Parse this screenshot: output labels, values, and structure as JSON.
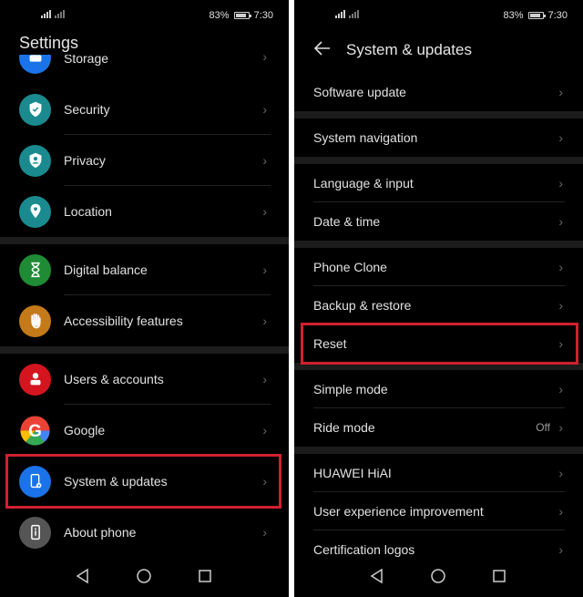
{
  "status_bar": {
    "battery": "83%",
    "time": "7:30"
  },
  "left": {
    "title": "Settings",
    "partial_item": {
      "label": "Storage",
      "icon": "storage-icon",
      "color": "#1a73e8"
    },
    "groups": [
      [
        {
          "label": "Security",
          "icon": "shield-check-icon",
          "color": "#1a8a8f"
        },
        {
          "label": "Privacy",
          "icon": "privacy-shield-icon",
          "color": "#1a8a8f"
        },
        {
          "label": "Location",
          "icon": "location-pin-icon",
          "color": "#1a8a8f"
        }
      ],
      [
        {
          "label": "Digital balance",
          "icon": "hourglass-icon",
          "color": "#1f8c35"
        },
        {
          "label": "Accessibility features",
          "icon": "hand-icon",
          "color": "#c47a18"
        }
      ],
      [
        {
          "label": "Users & accounts",
          "icon": "user-icon",
          "color": "#d4151f"
        },
        {
          "label": "Google",
          "icon": "google-icon",
          "color": "#ffffff"
        },
        {
          "label": "System & updates",
          "icon": "phone-gear-icon",
          "color": "#1a73e8",
          "highlighted": true
        },
        {
          "label": "About phone",
          "icon": "phone-info-icon",
          "color": "#555555"
        }
      ]
    ]
  },
  "right": {
    "title": "System & updates",
    "groups": [
      [
        {
          "label": "Software update"
        }
      ],
      [
        {
          "label": "System navigation"
        }
      ],
      [
        {
          "label": "Language & input"
        },
        {
          "label": "Date & time"
        }
      ],
      [
        {
          "label": "Phone Clone"
        },
        {
          "label": "Backup & restore"
        },
        {
          "label": "Reset",
          "highlighted": true
        }
      ],
      [
        {
          "label": "Simple mode"
        },
        {
          "label": "Ride mode",
          "value": "Off"
        }
      ],
      [
        {
          "label": "HUAWEI HiAI"
        },
        {
          "label": "User experience improvement"
        },
        {
          "label": "Certification logos"
        }
      ]
    ]
  },
  "highlight_color": "#d0202e",
  "chevron": "›"
}
